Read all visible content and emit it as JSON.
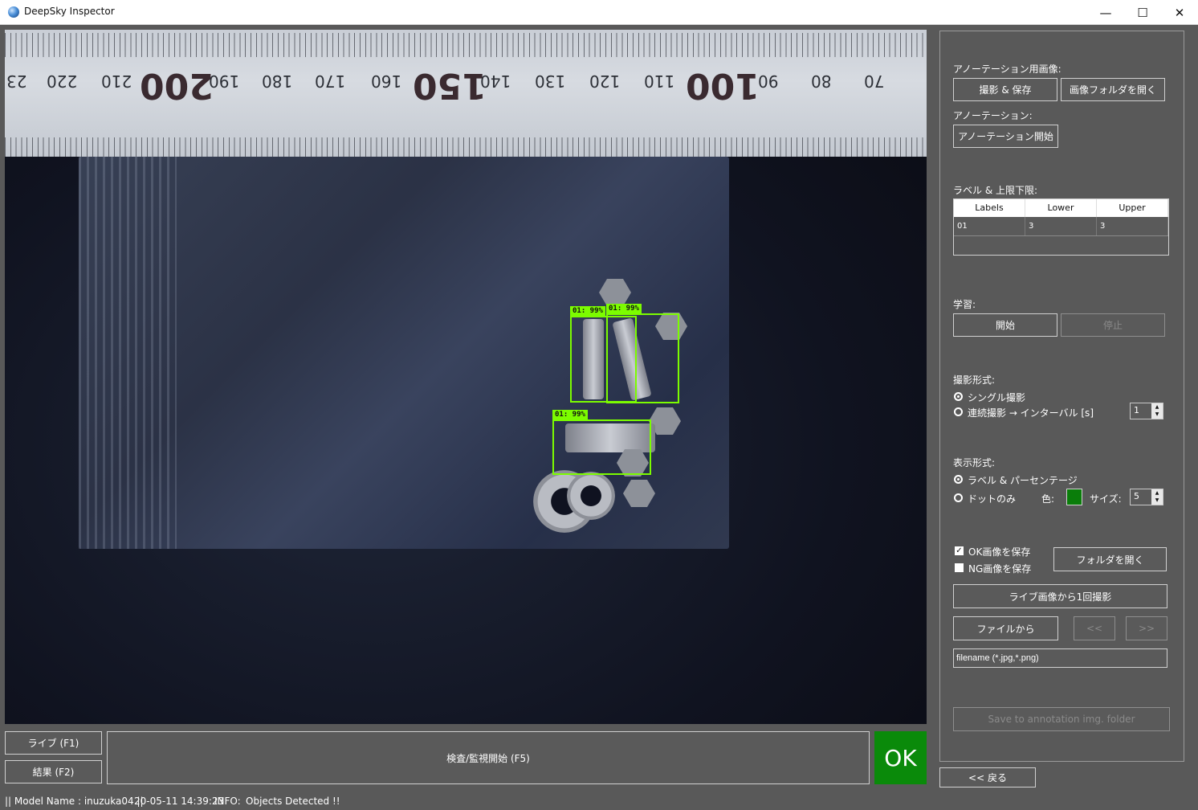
{
  "window": {
    "title": "DeepSky Inspector",
    "minimize": "—",
    "maximize": "☐",
    "close": "✕"
  },
  "ruler": {
    "labels": [
      "23",
      "220",
      "210",
      "200",
      "190",
      "180",
      "170",
      "160",
      "150",
      "140",
      "130",
      "120",
      "110",
      "100",
      "90",
      "80",
      "70"
    ]
  },
  "detections": [
    {
      "label": "01: 99%"
    },
    {
      "label": "01: 99%"
    },
    {
      "label": "01: 99%"
    }
  ],
  "bottom": {
    "live_button": "ライブ (F1)",
    "result_button": "結果 (F2)",
    "start_inspection_button": "検査/監視開始 (F5)",
    "result_indicator": "OK"
  },
  "panel": {
    "annotation_images_label": "アノーテーション用画像:",
    "capture_save_button": "撮影 & 保存",
    "open_image_folder_button": "画像フォルダを開く",
    "annotation_label": "アノーテーション:",
    "start_annotation_button": "アノーテーション開始",
    "labels_limits_label": "ラベル & 上限下限:",
    "table": {
      "headers": [
        "Labels",
        "Lower",
        "Upper"
      ],
      "rows": [
        [
          "01",
          "3",
          "3"
        ]
      ]
    },
    "training_label": "学習:",
    "train_start_button": "開始",
    "train_stop_button": "停止",
    "capture_mode_label": "撮影形式:",
    "capture_single": "シングル撮影",
    "capture_continuous": "連続撮影 → インターバル [s]",
    "interval_value": "1",
    "display_mode_label": "表示形式:",
    "display_label_percent": "ラベル & パーセンテージ",
    "display_dot_only": "ドットのみ",
    "color_label": "色:",
    "size_label": "サイズ:",
    "size_value": "5",
    "save_ok_label": "OK画像を保存",
    "save_ng_label": "NG画像を保存",
    "open_folder_button": "フォルダを開く",
    "capture_from_live_button": "ライブ画像から1回撮影",
    "from_file_button": "ファイルから",
    "prev_button": "<<",
    "next_button": ">>",
    "filename_placeholder": "filename (*.jpg,*.png)",
    "save_annotation_button": "Save to annotation img. folder",
    "back_button": "<< 戻る"
  },
  "status": {
    "model": "|| Model Name : inuzuka04 ||",
    "timestamp": "20-05-11 14:39:23",
    "info_label": "INFO:",
    "message": "Objects Detected !!"
  },
  "colors": {
    "ok_green": "#0a8a0a",
    "detection_green": "#7cfc00",
    "dot_color": "#0a7d0a"
  }
}
